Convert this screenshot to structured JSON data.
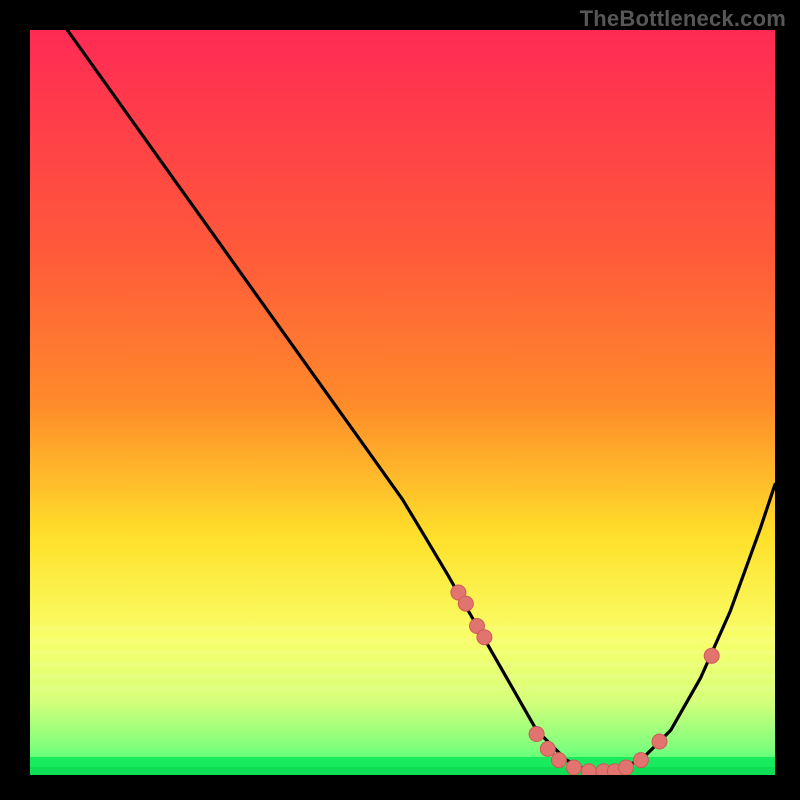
{
  "watermark": "TheBottleneck.com",
  "colors": {
    "bg": "#000000",
    "curve": "#000000",
    "dot_fill": "#e2746f",
    "dot_stroke": "#cd5a55",
    "gradient_top": "#ff2a54",
    "gradient_mid1": "#ff8a2a",
    "gradient_mid2": "#ffe02a",
    "gradient_mid3": "#f8ff6a",
    "gradient_bottom": "#2aff70",
    "bottom_band": "#12e85b"
  },
  "chart_data": {
    "type": "line",
    "title": "",
    "xlabel": "",
    "ylabel": "",
    "xlim": [
      0,
      100
    ],
    "ylim": [
      0,
      100
    ],
    "series": [
      {
        "name": "bottleneck-curve",
        "x": [
          5,
          10,
          15,
          20,
          25,
          30,
          35,
          40,
          45,
          50,
          53,
          56,
          60,
          64,
          68,
          72,
          75,
          78,
          82,
          86,
          90,
          94,
          98,
          100
        ],
        "y": [
          100,
          93,
          86,
          79,
          72,
          65,
          58,
          51,
          44,
          37,
          32,
          27,
          20,
          13,
          6,
          2,
          0.5,
          0.5,
          2,
          6,
          13,
          22,
          33,
          39
        ]
      }
    ],
    "dots": {
      "name": "highlight-points",
      "x": [
        57.5,
        58.5,
        60.0,
        61.0,
        68.0,
        69.5,
        71.0,
        73.0,
        75.0,
        77.0,
        78.5,
        80.0,
        82.0,
        84.5,
        91.5
      ],
      "y": [
        24.5,
        23.0,
        20.0,
        18.5,
        5.5,
        3.5,
        2.0,
        1.0,
        0.5,
        0.5,
        0.5,
        1.0,
        2.0,
        4.5,
        16.0
      ]
    }
  }
}
